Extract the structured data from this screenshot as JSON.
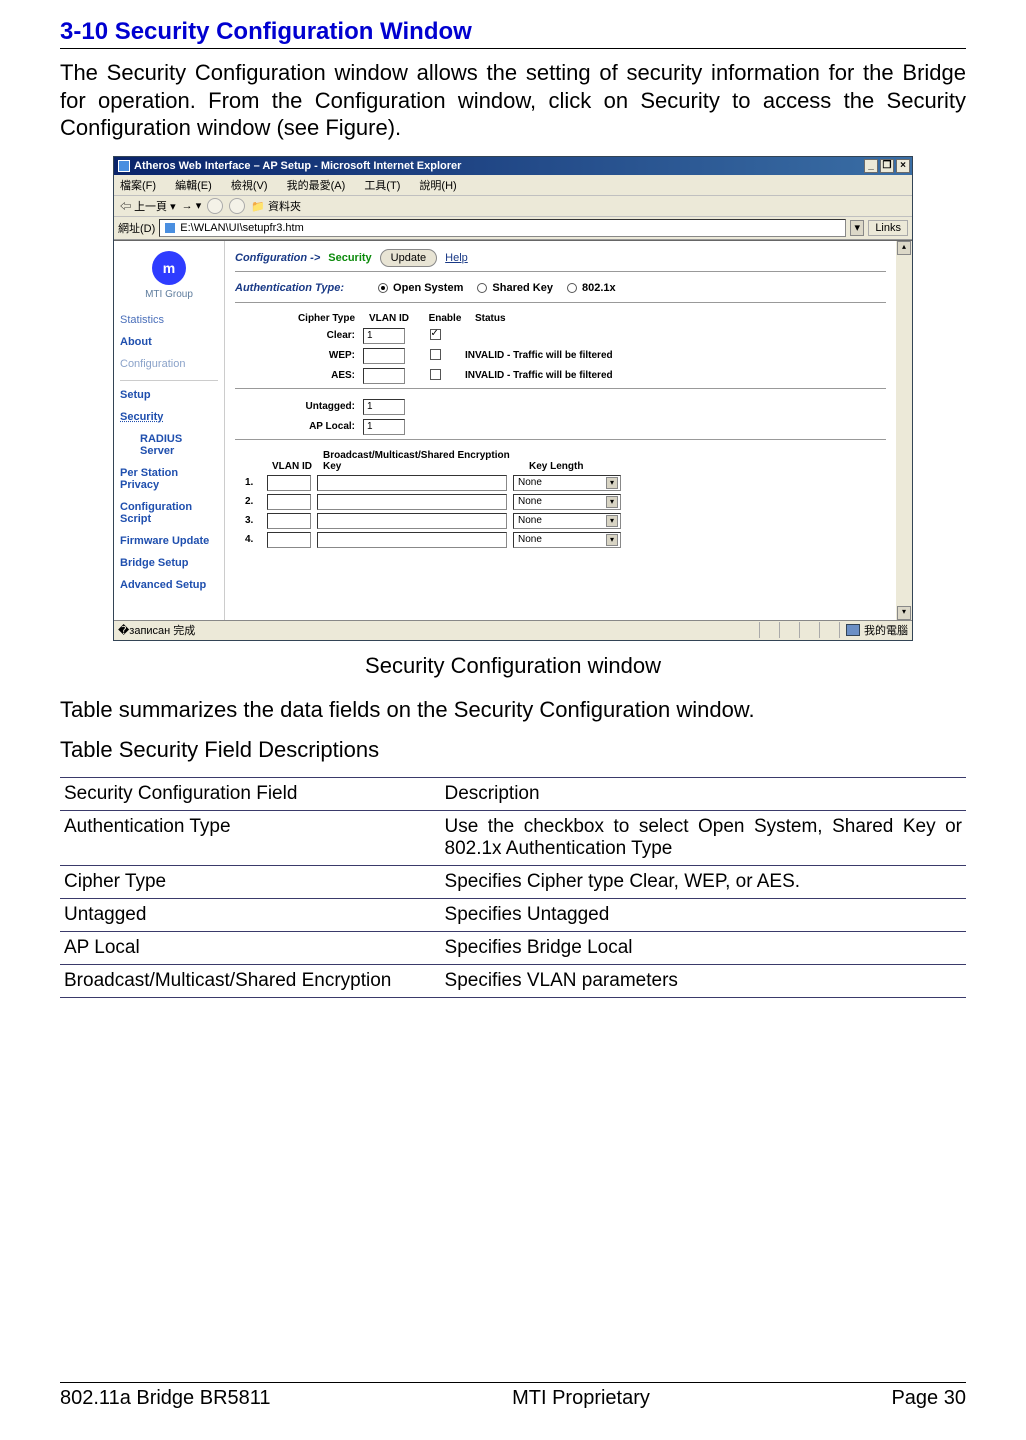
{
  "section_title": "3-10 Security Configuration Window",
  "intro": "The Security Configuration window allows the setting of security information for the Bridge for operation. From the Configuration window, click on Security to access the Security Configuration window (see Figure).",
  "ie": {
    "title": "Atheros Web Interface – AP Setup - Microsoft Internet Explorer",
    "menus": [
      "檔案(F)",
      "編輯(E)",
      "檢視(V)",
      "我的最愛(A)",
      "工具(T)",
      "說明(H)"
    ],
    "toolbar_back": "上一頁",
    "toolbar_folder": "資料夾",
    "address_label": "網址(D)",
    "address_value": "E:\\WLAN\\UI\\setupfr3.htm",
    "links_label": "Links",
    "status_done": "完成",
    "status_zone": "我的電腦"
  },
  "sidebar": {
    "logo_caption": "MTI Group",
    "items": [
      "Statistics",
      "About",
      "Configuration"
    ],
    "items2": [
      "Setup",
      "Security",
      "RADIUS Server",
      "Per Station Privacy",
      "Configuration Script",
      "Firmware Update",
      "Bridge Setup",
      "Advanced Setup"
    ]
  },
  "panel": {
    "crumb_conf": "Configuration ->",
    "crumb_cur": "Security",
    "update": "Update",
    "help": "Help",
    "auth_label": "Authentication Type:",
    "auth_opts": [
      "Open System",
      "Shared Key",
      "802.1x"
    ],
    "auth_selected": 0,
    "ct_headers": [
      "Cipher Type",
      "VLAN ID",
      "Enable",
      "Status"
    ],
    "ct_rows": [
      {
        "name": "Clear:",
        "vlan": "1",
        "enabled": true,
        "status": ""
      },
      {
        "name": "WEP:",
        "vlan": "",
        "enabled": false,
        "status": "INVALID - Traffic will be filtered"
      },
      {
        "name": "AES:",
        "vlan": "",
        "enabled": false,
        "status": "INVALID - Traffic will be filtered"
      }
    ],
    "untagged_label": "Untagged:",
    "untagged_value": "1",
    "aplocal_label": "AP Local:",
    "aplocal_value": "1",
    "enc_headers": [
      "VLAN ID",
      "Broadcast/Multicast/Shared Encryption Key",
      "Key Length"
    ],
    "enc_rows": [
      {
        "idx": "1.",
        "keylen": "None"
      },
      {
        "idx": "2.",
        "keylen": "None"
      },
      {
        "idx": "3.",
        "keylen": "None"
      },
      {
        "idx": "4.",
        "keylen": "None"
      }
    ]
  },
  "figure_caption": "Security Configuration window",
  "table_intro": "Table summarizes the data fields on the Security Configuration window.",
  "table_title": "Table Security Field Descriptions",
  "table": {
    "header": [
      "Security Configuration Field",
      "Description"
    ],
    "rows": [
      [
        "Authentication Type",
        "Use the checkbox to select Open System, Shared Key or 802.1x Authentication Type"
      ],
      [
        "Cipher Type",
        "Specifies Cipher type Clear, WEP, or AES."
      ],
      [
        "Untagged",
        "Specifies Untagged"
      ],
      [
        "AP Local",
        "Specifies Bridge Local"
      ],
      [
        "Broadcast/Multicast/Shared Encryption",
        "Specifies VLAN parameters"
      ]
    ]
  },
  "footer": {
    "left": "802.11a Bridge BR5811",
    "center": "MTI Proprietary",
    "right": "Page 30"
  }
}
